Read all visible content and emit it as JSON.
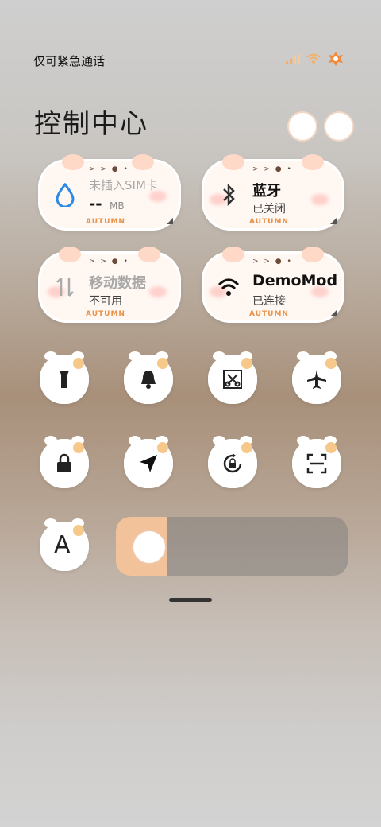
{
  "status": {
    "carrier_text": "仅可紧急通话",
    "icons": [
      "signal-icon",
      "wifi-icon",
      "leaf-icon"
    ]
  },
  "header": {
    "title": "控制中心",
    "icons": [
      "cat-sticker-icon",
      "cat-sticker-icon"
    ]
  },
  "tiles": {
    "data_usage": {
      "title": "未插入SIM卡",
      "value": "--",
      "unit": "MB",
      "badge": "AUTUMN"
    },
    "bluetooth": {
      "title": "蓝牙",
      "status": "已关闭",
      "badge": "AUTUMN"
    },
    "mobile_data": {
      "title": "移动数据",
      "status": "不可用",
      "badge": "AUTUMN"
    },
    "wifi": {
      "title": "DemoMod",
      "status": "已连接",
      "badge": "AUTUMN"
    }
  },
  "toggles": [
    {
      "name": "flashlight",
      "icon": "flashlight-icon"
    },
    {
      "name": "bell",
      "icon": "bell-icon"
    },
    {
      "name": "screenshot",
      "icon": "screenshot-icon"
    },
    {
      "name": "airplane",
      "icon": "airplane-icon"
    },
    {
      "name": "lock",
      "icon": "lock-icon"
    },
    {
      "name": "location",
      "icon": "location-arrow-icon"
    },
    {
      "name": "rotation",
      "icon": "rotation-lock-icon"
    },
    {
      "name": "scan",
      "icon": "scan-icon"
    },
    {
      "name": "font",
      "icon": "font-icon"
    }
  ],
  "font_toggle": {
    "label": "A"
  },
  "brightness": {
    "level": 0.22,
    "thumb_icon": "cat-sticker-icon"
  },
  "colors": {
    "accent": "#f2c39b",
    "tile_bg": "#fff7f2",
    "text_dark": "#111111"
  }
}
